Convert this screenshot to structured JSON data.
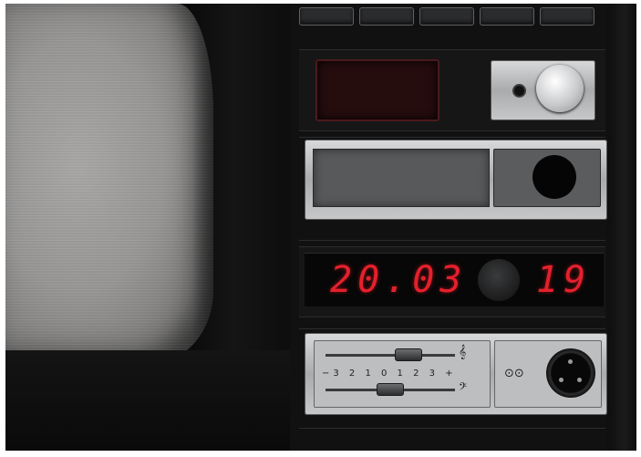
{
  "display": {
    "time": "20.03",
    "channel": "19",
    "digit_color": "#e4202c"
  },
  "sound_controls": {
    "scale": "−3 2 1 0 1 2 3 +",
    "treble_symbol": "𝄞",
    "bass_symbol": "𝄢",
    "tape_symbol": "⊙⊙"
  },
  "icons": [
    "headphone-jack-icon",
    "tape-icon",
    "treble-clef-icon",
    "bass-clef-icon"
  ]
}
